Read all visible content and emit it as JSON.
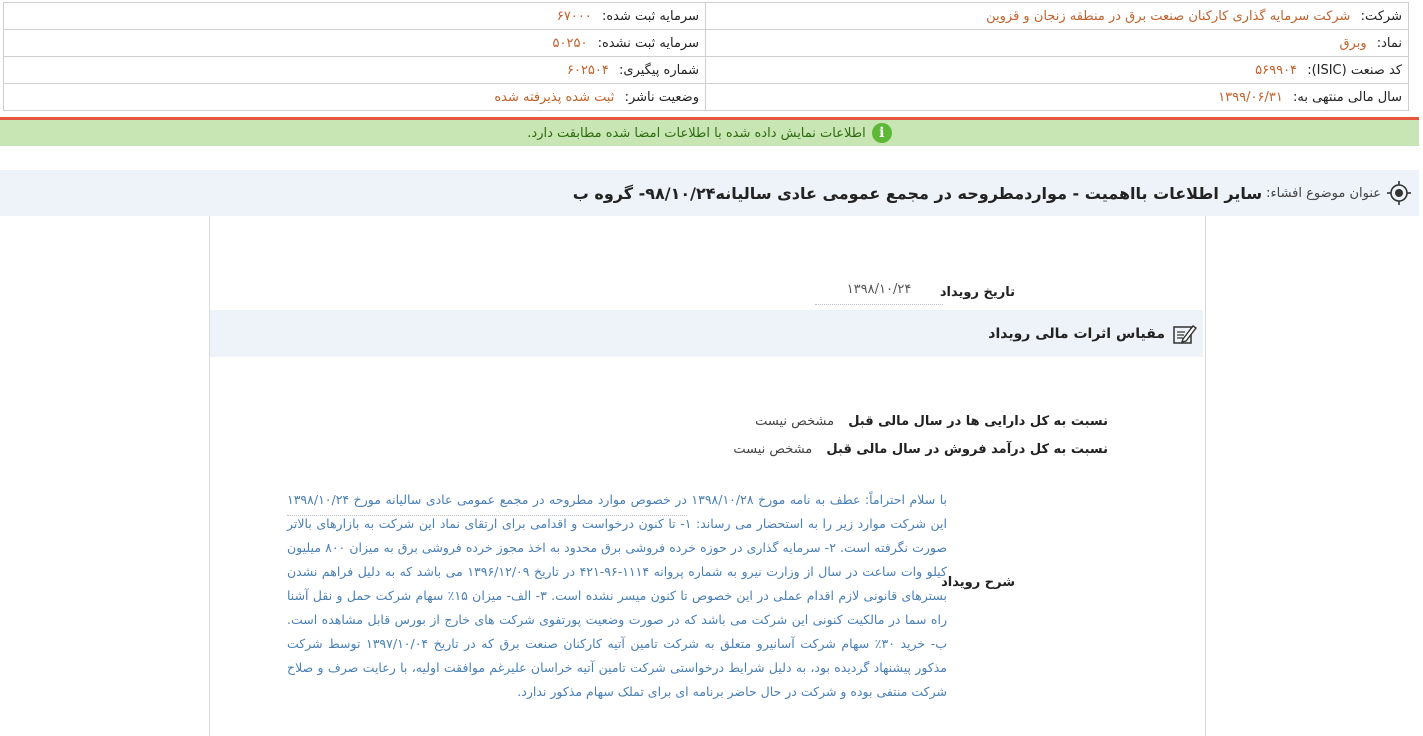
{
  "header": {
    "company_label": "شرکت:",
    "company_value": "شرکت سرمایه گذاری کارکنان صنعت برق در منطقه زنجان و قزوین",
    "registered_capital_label": "سرمایه ثبت شده:",
    "registered_capital_value": "۶۷۰۰۰",
    "symbol_label": "نماد:",
    "symbol_value": "وبرق",
    "unregistered_capital_label": "سرمایه ثبت نشده:",
    "unregistered_capital_value": "۵۰۲۵۰",
    "isic_label": "کد صنعت (ISIC):",
    "isic_value": "۵۶۹۹۰۴",
    "tracking_label": "شماره پیگیری:",
    "tracking_value": "۶۰۲۵۰۴",
    "fiscal_year_label": "سال مالی منتهی به:",
    "fiscal_year_value": "۱۳۹۹/۰۶/۳۱",
    "publisher_status_label": "وضعیت ناشر:",
    "publisher_status_value": "ثبت شده پذیرفته شده"
  },
  "notice": {
    "icon": "info-icon",
    "text": "اطلاعات نمایش داده شده با اطلاعات امضا شده مطابقت دارد."
  },
  "title": {
    "label": "عنوان موضوع افشاء:",
    "value": "سایر اطلاعات بااهمیت - مواردمطروحه در مجمع عمومی عادی سالیانه۹۸/۱۰/۲۴- گروه ب"
  },
  "event": {
    "date_label": "تاریخ رویداد",
    "date_value": "۱۳۹۸/۱۰/۲۴",
    "scale_title": "مقیاس اثرات مالی رویداد",
    "assets_ratio_label": "نسبت به کل دارایی ها در سال مالی قبل",
    "assets_ratio_value": "مشخص نیست",
    "revenue_ratio_label": "نسبت به کل درآمد فروش در سال مالی قبل",
    "revenue_ratio_value": "مشخص نیست",
    "description_label": "شرح رویداد",
    "description_text": "با سلام احتراماً: عطف به نامه مورخ ۱۳۹۸/۱۰/۲۸ در خصوص موارد مطروحه در مجمع عمومی عادی سالیانه مورخ ۱۳۹۸/۱۰/۲۴ این شرکت موارد زیر را به استحضار می رساند: ۱- تا کنون درخواست و اقدامی برای ارتقای نماد این شرکت به بازارهای بالاتر صورت نگرفته است. ۲- سرمایه گذاری در حوزه خرده فروشی برق محدود به اخذ مجوز خرده فروشی برق به میزان ۸۰۰ میلیون کیلو وات ساعت در سال از وزارت نیرو به شماره پروانه ۱۱۱۴-۹۶-۴۲۱ در تاریخ ۱۳۹۶/۱۲/۰۹ می باشد که به دلیل فراهم نشدن بسترهای قانونی لازم اقدام عملی در این خصوص تا کنون میسر نشده است. ۳- الف- میزان ۱۵٪ سهام شرکت حمل و نقل آشنا راه سما در مالکیت کنونی این شرکت می باشد که در صورت وضعیت پورتفوی شرکت های خارج از بورس قابل مشاهده است. ب- خرید ۳۰٪ سهام شرکت آسانیرو متعلق به شرکت تامین آتیه کارکنان صنعت برق که در تاریخ ۱۳۹۷/۱۰/۰۴ توسط شرکت مذکور پیشنهاد گردیده بود، به دلیل شرایط درخواستی شرکت تامین آتیه خراسان علیرغم موافقت اولیه، با رعایت صرف و صلاح شرکت منتفی بوده و شرکت در حال حاضر برنامه ای برای تملک سهام مذکور ندارد."
  },
  "colors": {
    "value_orange": "#c0622d",
    "notice_green": "#c8e6b3",
    "alert_red": "#e4573e",
    "desc_blue": "#4a7fb3"
  }
}
